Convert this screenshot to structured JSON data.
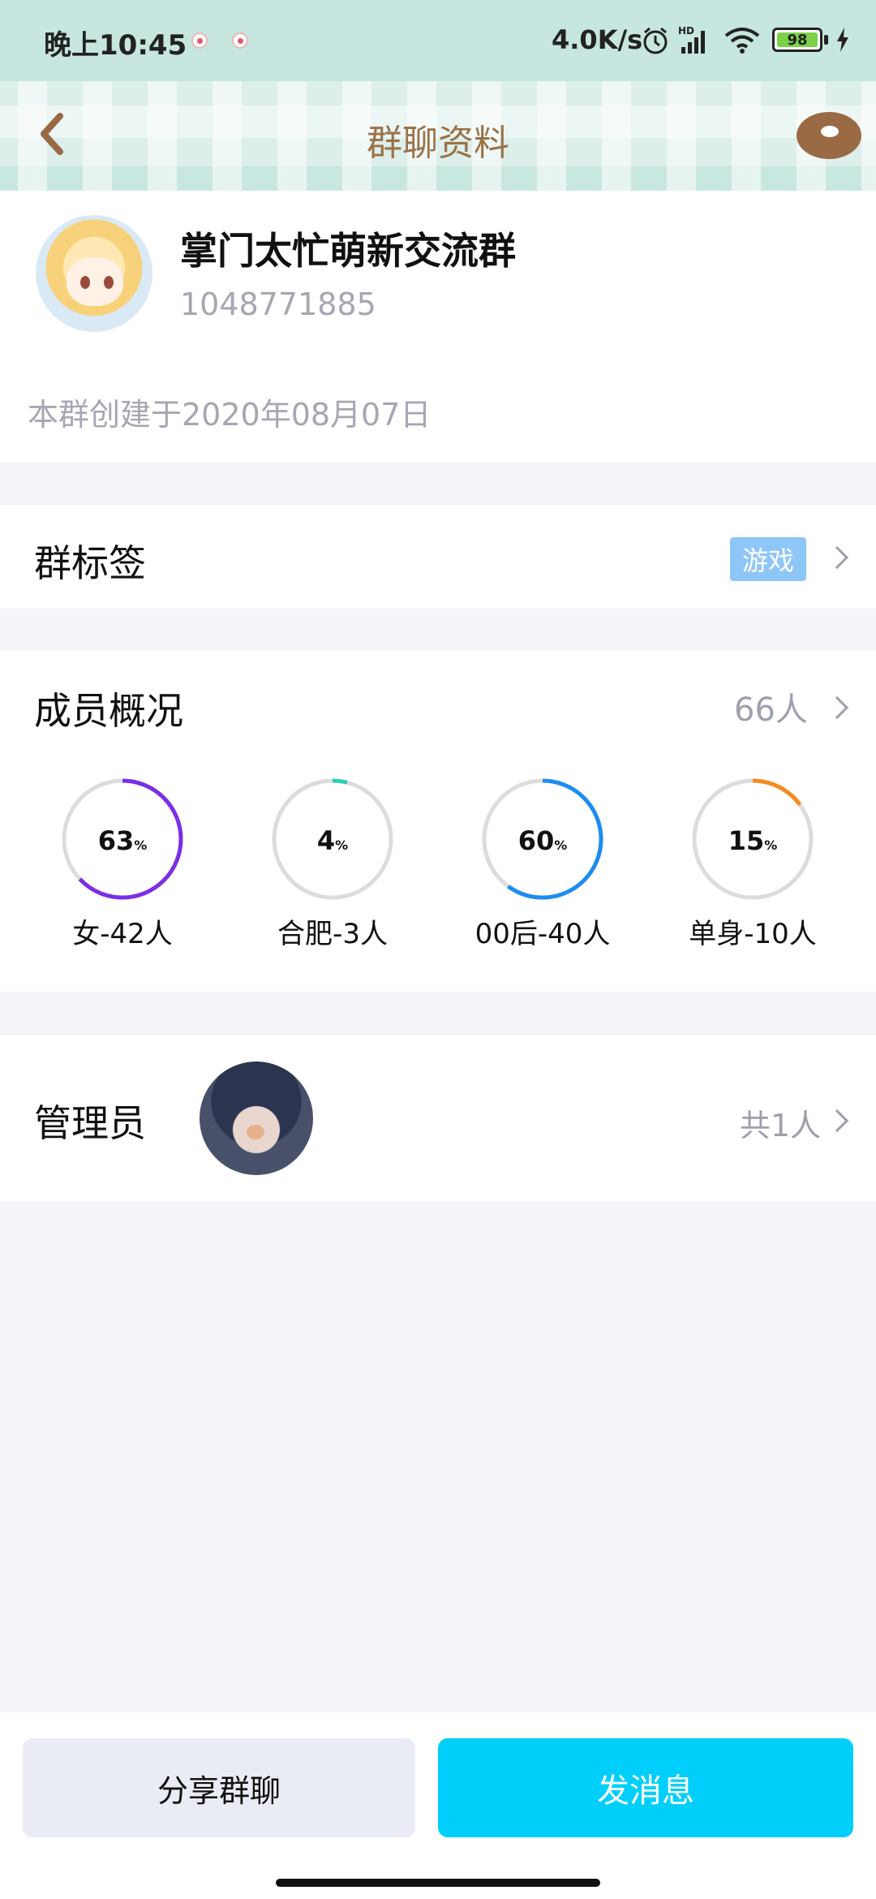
{
  "status_bar": {
    "time": "晚上10:45",
    "net_speed": "4.0K/s",
    "battery": "98",
    "icons": [
      "notification-heart-icon",
      "notification-heart-icon",
      "alarm-icon",
      "hd-signal-icon",
      "wifi-icon",
      "battery-icon",
      "charging-icon"
    ]
  },
  "header": {
    "title": "群聊资料",
    "back_icon": "chevron-left-icon",
    "right_icon": "donut-icon"
  },
  "group": {
    "name": "掌门太忙萌新交流群",
    "id": "1048771885",
    "created": "本群创建于2020年08月07日"
  },
  "tags": {
    "label": "群标签",
    "value": "游戏"
  },
  "members": {
    "label": "成员概况",
    "count": "66人",
    "stats": [
      {
        "value": "63",
        "unit": "%",
        "label": "女-42人",
        "fraction": 0.63,
        "color": "#7a2ee6"
      },
      {
        "value": "4",
        "unit": "%",
        "label": "合肥-3人",
        "fraction": 0.04,
        "color": "#2ecfb8"
      },
      {
        "value": "60",
        "unit": "%",
        "label": "00后-40人",
        "fraction": 0.6,
        "color": "#1e8cf0"
      },
      {
        "value": "15",
        "unit": "%",
        "label": "单身-10人",
        "fraction": 0.15,
        "color": "#f58a1f"
      }
    ]
  },
  "admins": {
    "label": "管理员",
    "count": "共1人"
  },
  "actions": {
    "share": "分享群聊",
    "send": "发消息"
  },
  "colors": {
    "accent": "#00cffb",
    "header_title": "#9a7248",
    "muted": "#a5a8b2"
  }
}
